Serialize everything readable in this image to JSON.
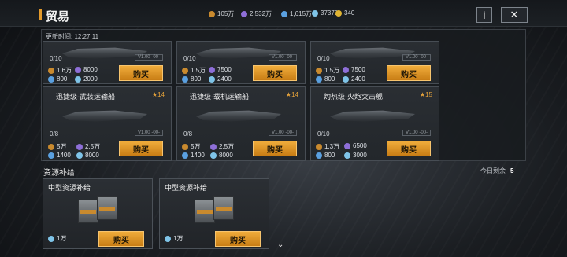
{
  "header": {
    "title": "贸易",
    "info_label": "i",
    "close_label": "✕"
  },
  "resources": [
    {
      "icon": "ore-icon",
      "value": "105万"
    },
    {
      "icon": "crystal-icon",
      "value": "2,532万"
    },
    {
      "icon": "gas-icon",
      "value": "1,615万"
    },
    {
      "icon": "chip-icon",
      "value": "37370"
    },
    {
      "icon": "gold-icon",
      "value": "340"
    }
  ],
  "update_time": {
    "label": "更新时间:",
    "value": "12:27:11"
  },
  "top_row": [
    {
      "count": "0/10",
      "version": "V1.00 -00-",
      "ore": "1.6万",
      "crystal": "8000",
      "gas": "800",
      "chip": "2000",
      "buy": "购买"
    },
    {
      "count": "0/10",
      "version": "V1.00 -00-",
      "ore": "1.5万",
      "crystal": "7500",
      "gas": "800",
      "chip": "2400",
      "buy": "购买"
    },
    {
      "count": "0/10",
      "version": "V1.00 -00-",
      "ore": "1.5万",
      "crystal": "7500",
      "gas": "800",
      "chip": "2400",
      "buy": "购买"
    }
  ],
  "ships": [
    {
      "name": "迅捷级-武装运输船",
      "level": "14",
      "count": "0/8",
      "version": "V1.00 -00-",
      "ore": "5万",
      "crystal": "2.5万",
      "gas": "1400",
      "chip": "8000",
      "buy": "购买"
    },
    {
      "name": "迅捷级-载机运输船",
      "level": "14",
      "count": "0/8",
      "version": "V1.00 -00-",
      "ore": "5万",
      "crystal": "2.5万",
      "gas": "1400",
      "chip": "8000",
      "buy": "购买"
    },
    {
      "name": "灼热级-火炮突击舰",
      "level": "15",
      "count": "0/10",
      "version": "V1.00 -00-",
      "ore": "1.3万",
      "crystal": "6500",
      "gas": "800",
      "chip": "3000",
      "buy": "购买"
    }
  ],
  "supply_section": {
    "title": "资源补给",
    "remaining_label": "今日剩余",
    "remaining_value": "5",
    "items": [
      {
        "name": "中型资源补给",
        "cost": "1万",
        "buy": "购买"
      },
      {
        "name": "中型资源补给",
        "cost": "1万",
        "buy": "购买"
      }
    ]
  },
  "colors": {
    "accent": "#e39a2b",
    "buy_button": "#e09a2a"
  }
}
